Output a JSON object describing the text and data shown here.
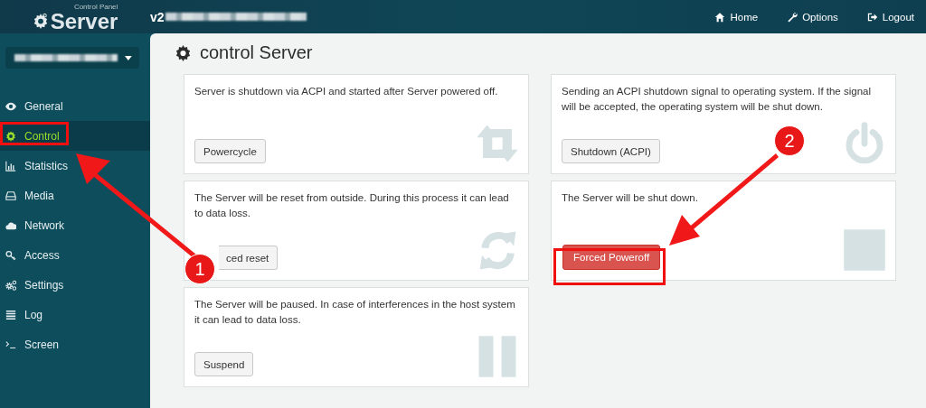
{
  "header": {
    "logo_subtitle": "Control Panel",
    "logo_title": "Server",
    "version": "v2",
    "nav": [
      {
        "label": "Home",
        "kind": "home"
      },
      {
        "label": "Options",
        "kind": "wrench"
      },
      {
        "label": "Logout",
        "kind": "logout"
      }
    ]
  },
  "sidebar": {
    "items": [
      {
        "label": "General",
        "kind": "eye",
        "selected": false
      },
      {
        "label": "Control",
        "kind": "gear",
        "selected": true
      },
      {
        "label": "Statistics",
        "kind": "chart",
        "selected": false
      },
      {
        "label": "Media",
        "kind": "drive",
        "selected": false
      },
      {
        "label": "Network",
        "kind": "cloud",
        "selected": false
      },
      {
        "label": "Access",
        "kind": "key",
        "selected": false
      },
      {
        "label": "Settings",
        "kind": "gears",
        "selected": false
      },
      {
        "label": "Log",
        "kind": "list",
        "selected": false
      },
      {
        "label": "Screen",
        "kind": "terminal",
        "selected": false
      }
    ]
  },
  "page_title": "control Server",
  "cards": [
    {
      "description": "Server is shutdown via ACPI and started after Server powered off.",
      "button": {
        "label": "Powercycle",
        "kind": "default"
      },
      "kind": "repeat"
    },
    {
      "description": "Sending an ACPI shutdown signal to operating system. If the signal will be accepted, the operating system will be shut down.",
      "button": {
        "label": "Shutdown (ACPI)",
        "kind": "default"
      },
      "kind": "power"
    },
    {
      "description": "The Server will be reset from outside. During this process it can lead to data loss.",
      "button": {
        "label": "ced reset",
        "kind": "covered"
      },
      "kind": "refresh"
    },
    {
      "description": "The Server will be shut down.",
      "button": {
        "label": "Forced Poweroff",
        "kind": "danger"
      },
      "kind": "stop"
    },
    {
      "description": "The Server will be paused. In case of interferences in the host system it can lead to data loss.",
      "button": {
        "label": "Suspend",
        "kind": "default"
      },
      "kind": "pause"
    }
  ],
  "annotations": [
    {
      "label": "1"
    },
    {
      "label": "2"
    }
  ]
}
